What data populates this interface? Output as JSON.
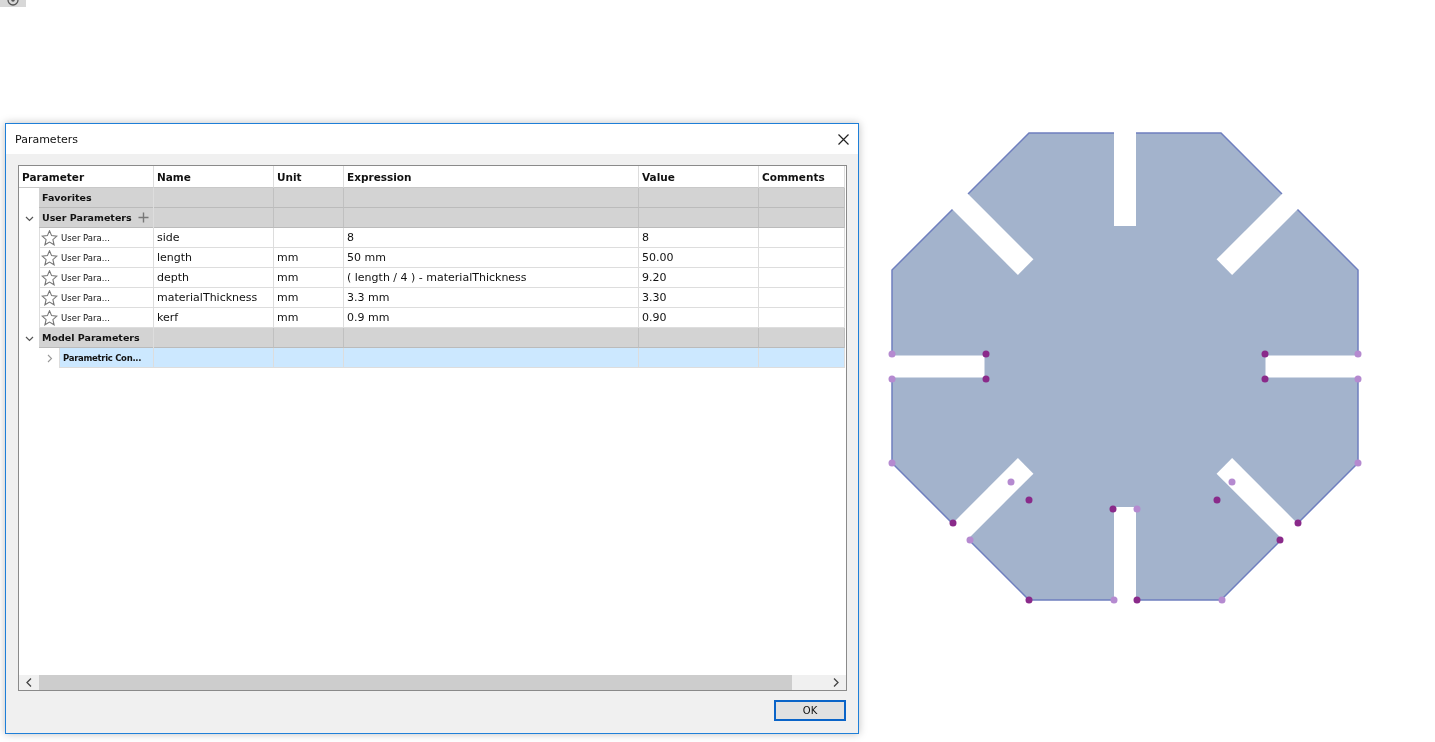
{
  "dialog": {
    "title": "Parameters",
    "ok_button": "OK"
  },
  "columns": [
    "Parameter",
    "Name",
    "Unit",
    "Expression",
    "Value",
    "Comments"
  ],
  "groups": [
    {
      "label": "Favorites"
    },
    {
      "label": "User Parameters",
      "expanded": true,
      "add_button": true,
      "children": [
        {
          "type_label": "User Para...",
          "favorite": false,
          "selected": false,
          "name": "side",
          "expression": "8",
          "value": "8"
        },
        {
          "type_label": "User Para...",
          "favorite": false,
          "selected": false,
          "name": "length",
          "unit": "mm",
          "expression": "50 mm",
          "value": "50.00"
        },
        {
          "type_label": "User Para...",
          "favorite": false,
          "selected": false,
          "name": "depth",
          "unit": "mm",
          "expression": "( length / 4 ) - materialThickness",
          "value": "9.20"
        },
        {
          "type_label": "User Para...",
          "favorite": false,
          "selected": false,
          "name": "materialThickness",
          "unit": "mm",
          "expression": "3.3 mm",
          "value": "3.30"
        },
        {
          "type_label": "User Para...",
          "favorite": false,
          "selected": false,
          "name": "kerf",
          "unit": "mm",
          "expression": "0.9 mm",
          "value": "0.90"
        }
      ]
    },
    {
      "label": "Model Parameters",
      "expanded": true,
      "add_button": false,
      "children": [
        {
          "kind": "component",
          "label": "Parametric Con...",
          "expanded": false,
          "selected": true
        }
      ]
    }
  ]
}
